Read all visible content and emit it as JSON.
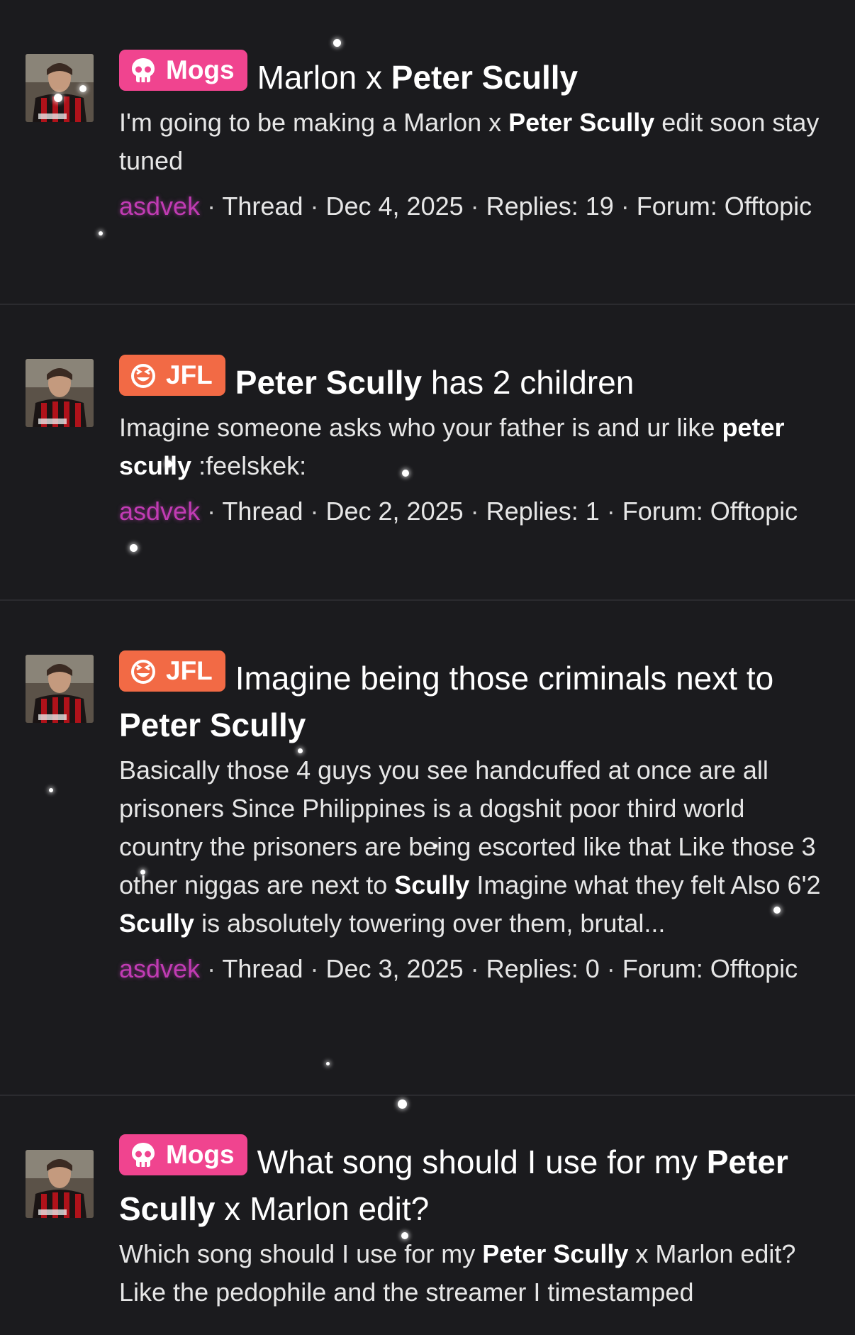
{
  "colors": {
    "background": "#1b1b1e",
    "mogs_prefix": "#f0448f",
    "jfl_prefix": "#f26a45",
    "username": "#c13bb3"
  },
  "results": [
    {
      "prefix": "Mogs",
      "prefix_icon": "skull-icon",
      "title_parts": [
        "Marlon x ",
        "Peter Scully",
        ""
      ],
      "snippet_parts": [
        "I'm going to be making a Marlon x ",
        "Peter Scully",
        " edit soon stay tuned"
      ],
      "author": "asdvek",
      "type": "Thread",
      "date": "Dec 4, 2025",
      "replies": "Replies: 19",
      "forum": "Forum: Offtopic"
    },
    {
      "prefix": "JFL",
      "prefix_icon": "laughing-face-icon",
      "title_parts": [
        "",
        "Peter Scully",
        " has 2 children"
      ],
      "snippet_parts": [
        "Imagine someone asks who your father is and ur like ",
        "peter scully",
        " :feelskek:"
      ],
      "author": "asdvek",
      "type": "Thread",
      "date": "Dec 2, 2025",
      "replies": "Replies: 1",
      "forum": "Forum: Offtopic"
    },
    {
      "prefix": "JFL",
      "prefix_icon": "laughing-face-icon",
      "title_parts": [
        "Imagine being those criminals next to ",
        "Peter Scully",
        ""
      ],
      "snippet_parts": [
        "Basically those 4 guys you see handcuffed at once are all prisoners Since Philippines is a dogshit poor third world country the prisoners are being escorted like that Like those 3 other niggas are next to ",
        "Scully",
        " Imagine what they felt Also 6'2 ",
        "Scully",
        " is absolutely towering over them, brutal..."
      ],
      "author": "asdvek",
      "type": "Thread",
      "date": "Dec 3, 2025",
      "replies": "Replies: 0",
      "forum": "Forum: Offtopic"
    },
    {
      "prefix": "Mogs",
      "prefix_icon": "skull-icon",
      "title_parts": [
        "What song should I use for my ",
        "Peter Scully",
        " x Marlon edit?"
      ],
      "snippet_parts": [
        "Which song should I use for my ",
        "Peter Scully",
        " x Marlon edit? Like the pedophile and the streamer I timestamped"
      ]
    }
  ]
}
